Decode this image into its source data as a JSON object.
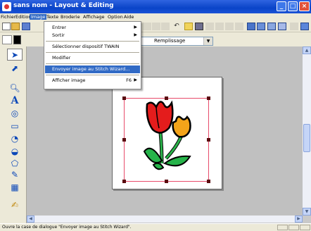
{
  "window": {
    "title": "sans nom - Layout & Editing"
  },
  "menubar": {
    "items": [
      "Fichier",
      "Edition",
      "Image",
      "Texte",
      "Broderie",
      "Affichage",
      "Option",
      "Aide"
    ]
  },
  "toolbar": {
    "mode_combo": "Remplissage"
  },
  "image_menu": {
    "items": [
      {
        "label": "Entrer",
        "submenu": true
      },
      {
        "label": "Sortir",
        "submenu": true
      },
      {
        "label": "Sélectionner dispositif TWAIN"
      },
      {
        "label": "Modifier"
      },
      {
        "label": "Envoyer image au Stitch Wizard..."
      },
      {
        "label": "Afficher image",
        "shortcut": "F6",
        "submenu": true
      }
    ]
  },
  "statusbar": {
    "text": "Ouvre la case de dialogue \"Envoyer image au Stitch Wizard\"."
  },
  "colors": {
    "accent": "#316ac5",
    "titlebar": "#0a44c8",
    "selection": "#e84b6a"
  }
}
